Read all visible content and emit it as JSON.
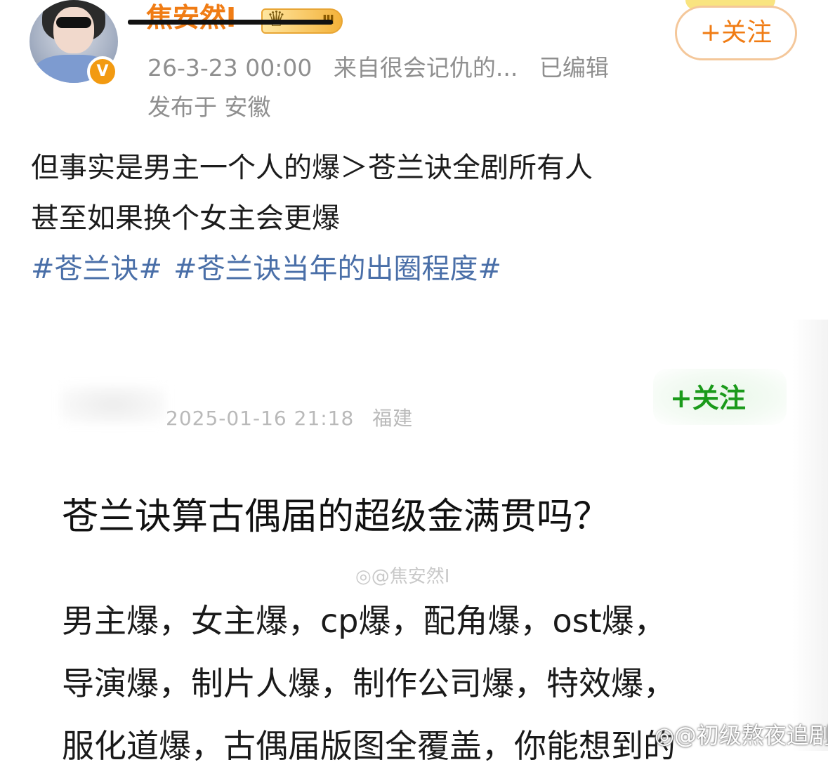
{
  "header": {
    "username": "焦安然I",
    "level_badge": "Ⅲ",
    "verified_badge": "V",
    "follow_label": "+关注",
    "timestamp": "26-3-23 00:00",
    "source": "来自很会记仇的...",
    "edited": "已编辑",
    "location": "发布于 安徽"
  },
  "post": {
    "lines": [
      "但事实是男主一个人的爆＞苍兰诀全剧所有人",
      "甚至如果换个女主会更爆"
    ],
    "tags": [
      "#苍兰诀#",
      "#苍兰诀当年的出圈程度#"
    ]
  },
  "embed": {
    "meta_time": "2025-01-16 21:18",
    "meta_location": "福建",
    "follow_label": "+关注",
    "title": "苍兰诀算古偶届的超级金满贯吗？",
    "watermark": "@焦安然I",
    "body_lines": [
      "男主爆，女主爆，cp爆，配角爆，ost爆，",
      "导演爆，制片人爆，制作公司爆，特效爆，",
      "服化道爆，古偶届版图全覆盖，你能想到的"
    ]
  },
  "footer": {
    "watermark": "@初级熬夜追剧"
  },
  "colors": {
    "accent_orange": "#f07c14",
    "tag_blue": "#4a6fa8",
    "meta_gray": "#8f8f8f",
    "follow_green": "#1a9a1a"
  }
}
